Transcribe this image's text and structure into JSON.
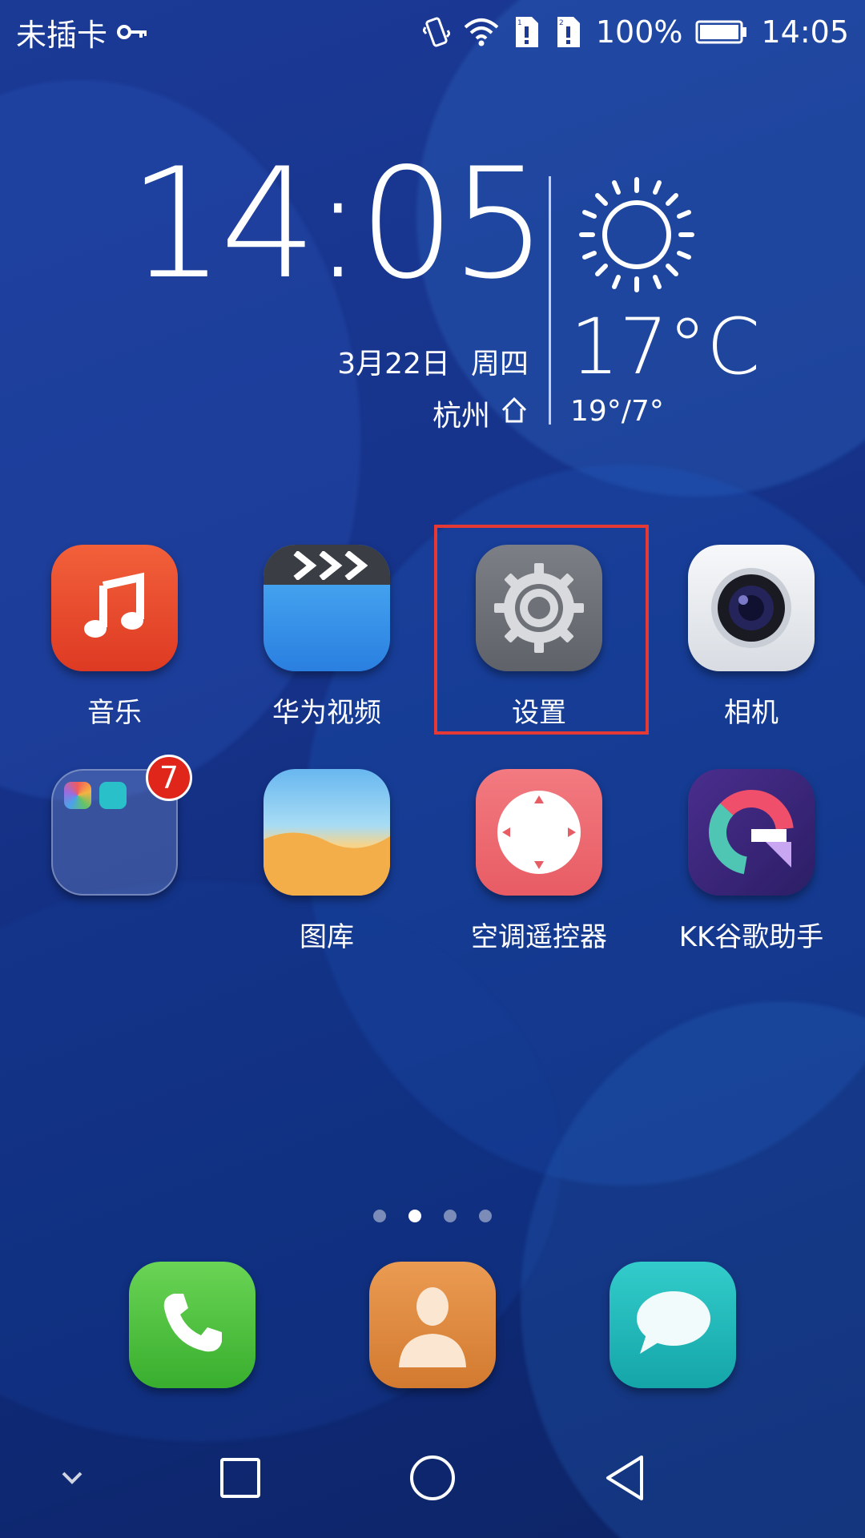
{
  "status_bar": {
    "carrier": "未插卡",
    "battery_percent": "100%",
    "time": "14:05",
    "icons": [
      "key-icon",
      "vibrate-icon",
      "wifi-icon",
      "sim1-alert-icon",
      "sim2-alert-icon",
      "battery-icon"
    ]
  },
  "clock_widget": {
    "time": "14:05",
    "date": "3月22日",
    "weekday": "周四",
    "city": "杭州",
    "temperature": "17°C",
    "range": "19°/7°",
    "weather_icon": "sun-icon"
  },
  "apps": [
    {
      "label": "音乐",
      "icon": "music-icon",
      "color": "#e8452b"
    },
    {
      "label": "华为视频",
      "icon": "video-clapper-icon",
      "color": "#2e8ae6"
    },
    {
      "label": "设置",
      "icon": "gear-icon",
      "color": "#6e7178"
    },
    {
      "label": "相机",
      "icon": "camera-icon",
      "color": "#e8ebef"
    },
    {
      "label": "",
      "icon": "folder-icon",
      "badge": "7"
    },
    {
      "label": "图库",
      "icon": "gallery-icon",
      "color": "#f3b14e"
    },
    {
      "label": "空调遥控器",
      "icon": "remote-control-icon",
      "color": "#ef6b72"
    },
    {
      "label": "KK谷歌助手",
      "icon": "kk-google-icon",
      "color": "#3c2a7a"
    }
  ],
  "highlight": {
    "target": "设置",
    "color": "#e53935"
  },
  "page_indicator": {
    "total": 4,
    "active_index": 1
  },
  "dock": [
    {
      "icon": "phone-icon",
      "color": "#4cc23f"
    },
    {
      "icon": "contacts-icon",
      "color": "#e08a3c"
    },
    {
      "icon": "messages-icon",
      "color": "#1fb8b6"
    }
  ],
  "nav_bar": [
    "chevron-down-icon",
    "recents-icon",
    "home-icon",
    "back-icon"
  ]
}
